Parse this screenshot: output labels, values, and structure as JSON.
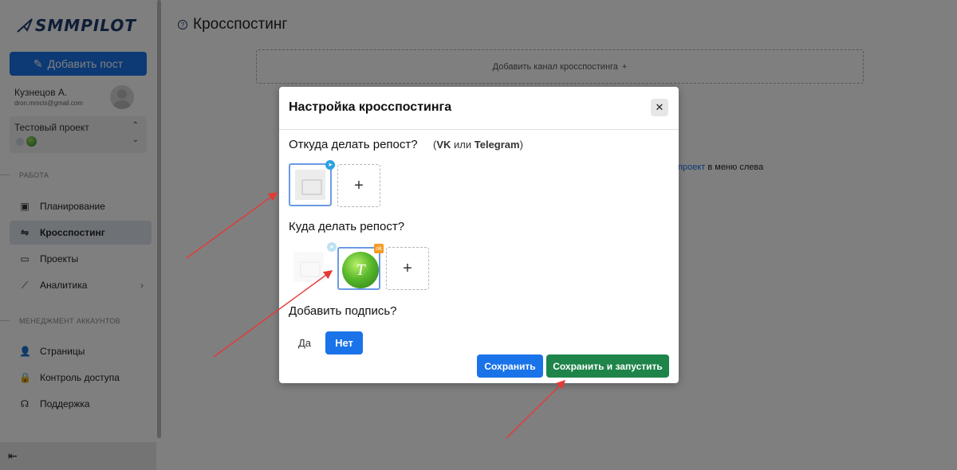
{
  "sidebar": {
    "logo_text": "SMMPILOT",
    "add_post_label": "Добавить пост",
    "user_name": "Кузнецов А.",
    "user_email": "dron.mmcis@gmail.com",
    "project_name": "Тестовый проект",
    "section_work": "РАБОТА",
    "section_accounts": "МЕНЕДЖМЕНТ АККАУНТОВ",
    "nav": [
      {
        "label": "Планирование",
        "icon": "calendar-icon"
      },
      {
        "label": "Кросспостинг",
        "icon": "swap-arrows-icon",
        "active": true
      },
      {
        "label": "Проекты",
        "icon": "folder-icon"
      },
      {
        "label": "Аналитика",
        "icon": "chart-icon"
      }
    ],
    "nav_accounts": [
      {
        "label": "Страницы",
        "icon": "user-plus-icon"
      },
      {
        "label": "Контроль доступа",
        "icon": "lock-icon"
      },
      {
        "label": "Поддержка",
        "icon": "headset-icon"
      }
    ]
  },
  "main": {
    "title": "Кросспостинг",
    "add_channel_label": "Добавить канал кросспостинга",
    "hint_link": "проект",
    "hint_rest": " в меню слева"
  },
  "modal": {
    "title": "Настройка кросспостинга",
    "source_question": "Откуда делать репост?",
    "source_hint_open": "(",
    "source_hint_vk": "VK",
    "source_hint_or": " или ",
    "source_hint_tg": "Telegram",
    "source_hint_close": ")",
    "target_question": "Куда делать репост?",
    "signature_question": "Добавить подпись?",
    "yes_label": "Да",
    "no_label": "Нет",
    "save_label": "Сохранить",
    "save_run_label": "Сохранить и запустить",
    "target_avatar_letter": "T"
  },
  "colors": {
    "primary": "#1a73e8",
    "success": "#1e8449",
    "telegram": "#2aa3e0",
    "odnoklassniki": "#f59a23",
    "annotation_arrow": "#e53935"
  }
}
